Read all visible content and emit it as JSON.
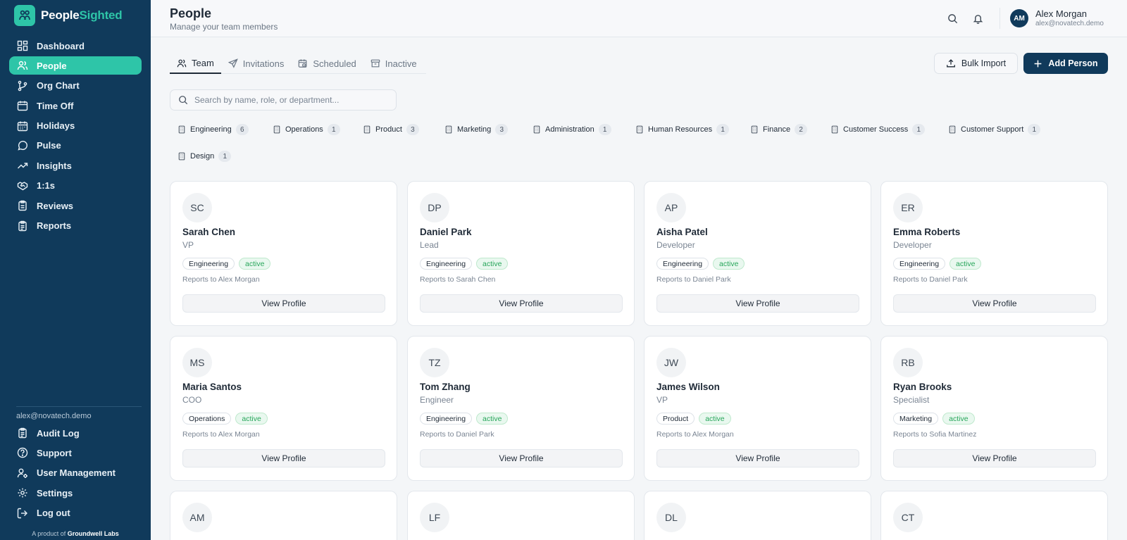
{
  "brand": {
    "name_part1": "People",
    "name_part2": "Sighted",
    "accent": "#2ec5a8",
    "sidebar_bg": "#103a5b"
  },
  "sidebar": {
    "items": [
      {
        "label": "Dashboard",
        "icon": "dashboard-icon"
      },
      {
        "label": "People",
        "icon": "people-icon",
        "active": true
      },
      {
        "label": "Org Chart",
        "icon": "org-chart-icon"
      },
      {
        "label": "Time Off",
        "icon": "calendar-icon"
      },
      {
        "label": "Holidays",
        "icon": "calendar-days-icon"
      },
      {
        "label": "Pulse",
        "icon": "chat-bubble-icon"
      },
      {
        "label": "Insights",
        "icon": "trend-up-icon"
      },
      {
        "label": "1:1s",
        "icon": "handshake-icon"
      },
      {
        "label": "Reviews",
        "icon": "clipboard-icon"
      },
      {
        "label": "Reports",
        "icon": "clipboard-list-icon"
      }
    ],
    "account_email": "alex@novatech.demo",
    "bottom_items": [
      {
        "label": "Audit Log",
        "icon": "clipboard-icon"
      },
      {
        "label": "Support",
        "icon": "help-circle-icon"
      },
      {
        "label": "User Management",
        "icon": "user-cog-icon"
      },
      {
        "label": "Settings",
        "icon": "gear-icon"
      },
      {
        "label": "Log out",
        "icon": "logout-icon"
      }
    ],
    "footer_prefix": "A product of",
    "footer_company": "Groundwell Labs"
  },
  "header": {
    "title": "People",
    "subtitle": "Manage your team members",
    "user": {
      "initials": "AM",
      "name": "Alex Morgan",
      "email": "alex@novatech.demo"
    }
  },
  "tabs": [
    {
      "label": "Team",
      "icon": "users-icon",
      "active": true
    },
    {
      "label": "Invitations",
      "icon": "send-icon"
    },
    {
      "label": "Scheduled",
      "icon": "calendar-clock-icon"
    },
    {
      "label": "Inactive",
      "icon": "archive-icon"
    }
  ],
  "actions": {
    "bulk_import": "Bulk Import",
    "add_person": "Add Person"
  },
  "search": {
    "placeholder": "Search by name, role, or department...",
    "value": ""
  },
  "departments": [
    {
      "name": "Engineering",
      "count": "6"
    },
    {
      "name": "Operations",
      "count": "1"
    },
    {
      "name": "Product",
      "count": "3"
    },
    {
      "name": "Marketing",
      "count": "3"
    },
    {
      "name": "Administration",
      "count": "1"
    },
    {
      "name": "Human Resources",
      "count": "1"
    },
    {
      "name": "Finance",
      "count": "2"
    },
    {
      "name": "Customer Success",
      "count": "1"
    },
    {
      "name": "Customer Support",
      "count": "1"
    },
    {
      "name": "Design",
      "count": "1"
    }
  ],
  "view_profile_label": "View Profile",
  "people": [
    {
      "initials": "SC",
      "name": "Sarah Chen",
      "role": "VP",
      "dept": "Engineering",
      "status": "active",
      "reports_to": "Reports to Alex Morgan"
    },
    {
      "initials": "DP",
      "name": "Daniel Park",
      "role": "Lead",
      "dept": "Engineering",
      "status": "active",
      "reports_to": "Reports to Sarah Chen"
    },
    {
      "initials": "AP",
      "name": "Aisha Patel",
      "role": "Developer",
      "dept": "Engineering",
      "status": "active",
      "reports_to": "Reports to Daniel Park"
    },
    {
      "initials": "ER",
      "name": "Emma Roberts",
      "role": "Developer",
      "dept": "Engineering",
      "status": "active",
      "reports_to": "Reports to Daniel Park"
    },
    {
      "initials": "MS",
      "name": "Maria Santos",
      "role": "COO",
      "dept": "Operations",
      "status": "active",
      "reports_to": "Reports to Alex Morgan"
    },
    {
      "initials": "TZ",
      "name": "Tom Zhang",
      "role": "Engineer",
      "dept": "Engineering",
      "status": "active",
      "reports_to": "Reports to Daniel Park"
    },
    {
      "initials": "JW",
      "name": "James Wilson",
      "role": "VP",
      "dept": "Product",
      "status": "active",
      "reports_to": "Reports to Alex Morgan"
    },
    {
      "initials": "RB",
      "name": "Ryan Brooks",
      "role": "Specialist",
      "dept": "Marketing",
      "status": "active",
      "reports_to": "Reports to Sofia Martinez"
    },
    {
      "initials": "AM"
    },
    {
      "initials": "LF"
    },
    {
      "initials": "DL"
    },
    {
      "initials": "CT"
    }
  ]
}
